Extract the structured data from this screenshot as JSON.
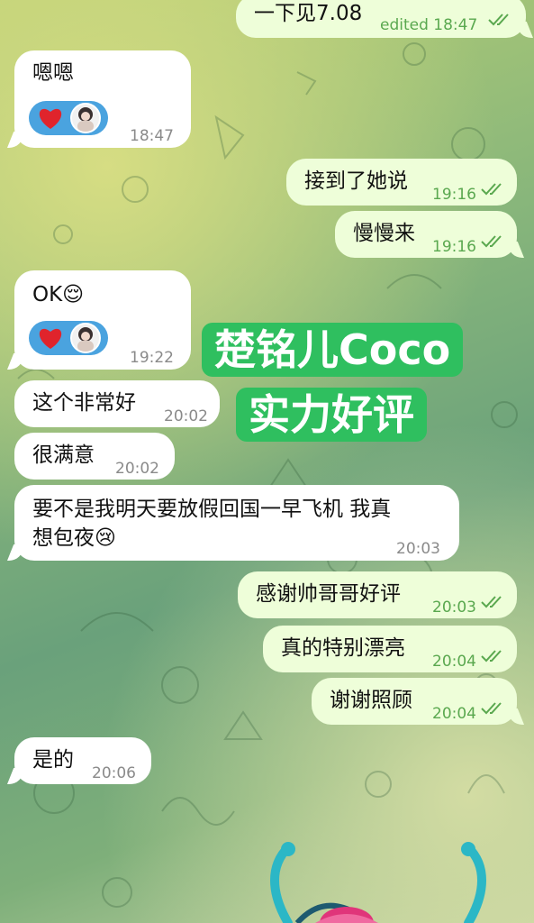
{
  "messages": [
    {
      "id": "m1",
      "direction": "out",
      "text": "一下见7.08",
      "time": "edited 18:47",
      "read": true
    },
    {
      "id": "m2",
      "direction": "in",
      "text": "嗯嗯",
      "time": "18:47",
      "reaction": {
        "emoji": "heart",
        "has_avatar": true
      }
    },
    {
      "id": "m3",
      "direction": "out",
      "text": "接到了她说",
      "time": "19:16",
      "read": true
    },
    {
      "id": "m4",
      "direction": "out",
      "text": "慢慢来",
      "time": "19:16",
      "read": true
    },
    {
      "id": "m5",
      "direction": "in",
      "text": "OK😌",
      "time": "19:22",
      "reaction": {
        "emoji": "heart",
        "has_avatar": true
      }
    },
    {
      "id": "m6",
      "direction": "in",
      "text": "这个非常好",
      "time": "20:02"
    },
    {
      "id": "m7",
      "direction": "in",
      "text": "很满意",
      "time": "20:02"
    },
    {
      "id": "m8",
      "direction": "in",
      "text_line1": "要不是我明天要放假回国一早飞机 我真",
      "text_line2": "想包夜😢",
      "time": "20:03"
    },
    {
      "id": "m9",
      "direction": "out",
      "text": "感谢帅哥哥好评",
      "time": "20:03",
      "read": true
    },
    {
      "id": "m10",
      "direction": "out",
      "text": "真的特别漂亮",
      "time": "20:04",
      "read": true
    },
    {
      "id": "m11",
      "direction": "out",
      "text": "谢谢照顾",
      "time": "20:04",
      "read": true
    },
    {
      "id": "m12",
      "direction": "in",
      "text": "是的",
      "time": "20:06"
    }
  ],
  "overlay": {
    "line1": "楚铭儿Coco",
    "line2": "实力好评",
    "color": "#2fbf5f"
  },
  "colors": {
    "incoming_bubble": "#ffffff",
    "outgoing_bubble": "#eefed9",
    "outgoing_time": "#5aa84f",
    "reaction_bg": "#4aa3df"
  },
  "icons": {
    "read_receipt": "double-check-icon",
    "reaction": "heart-icon"
  }
}
